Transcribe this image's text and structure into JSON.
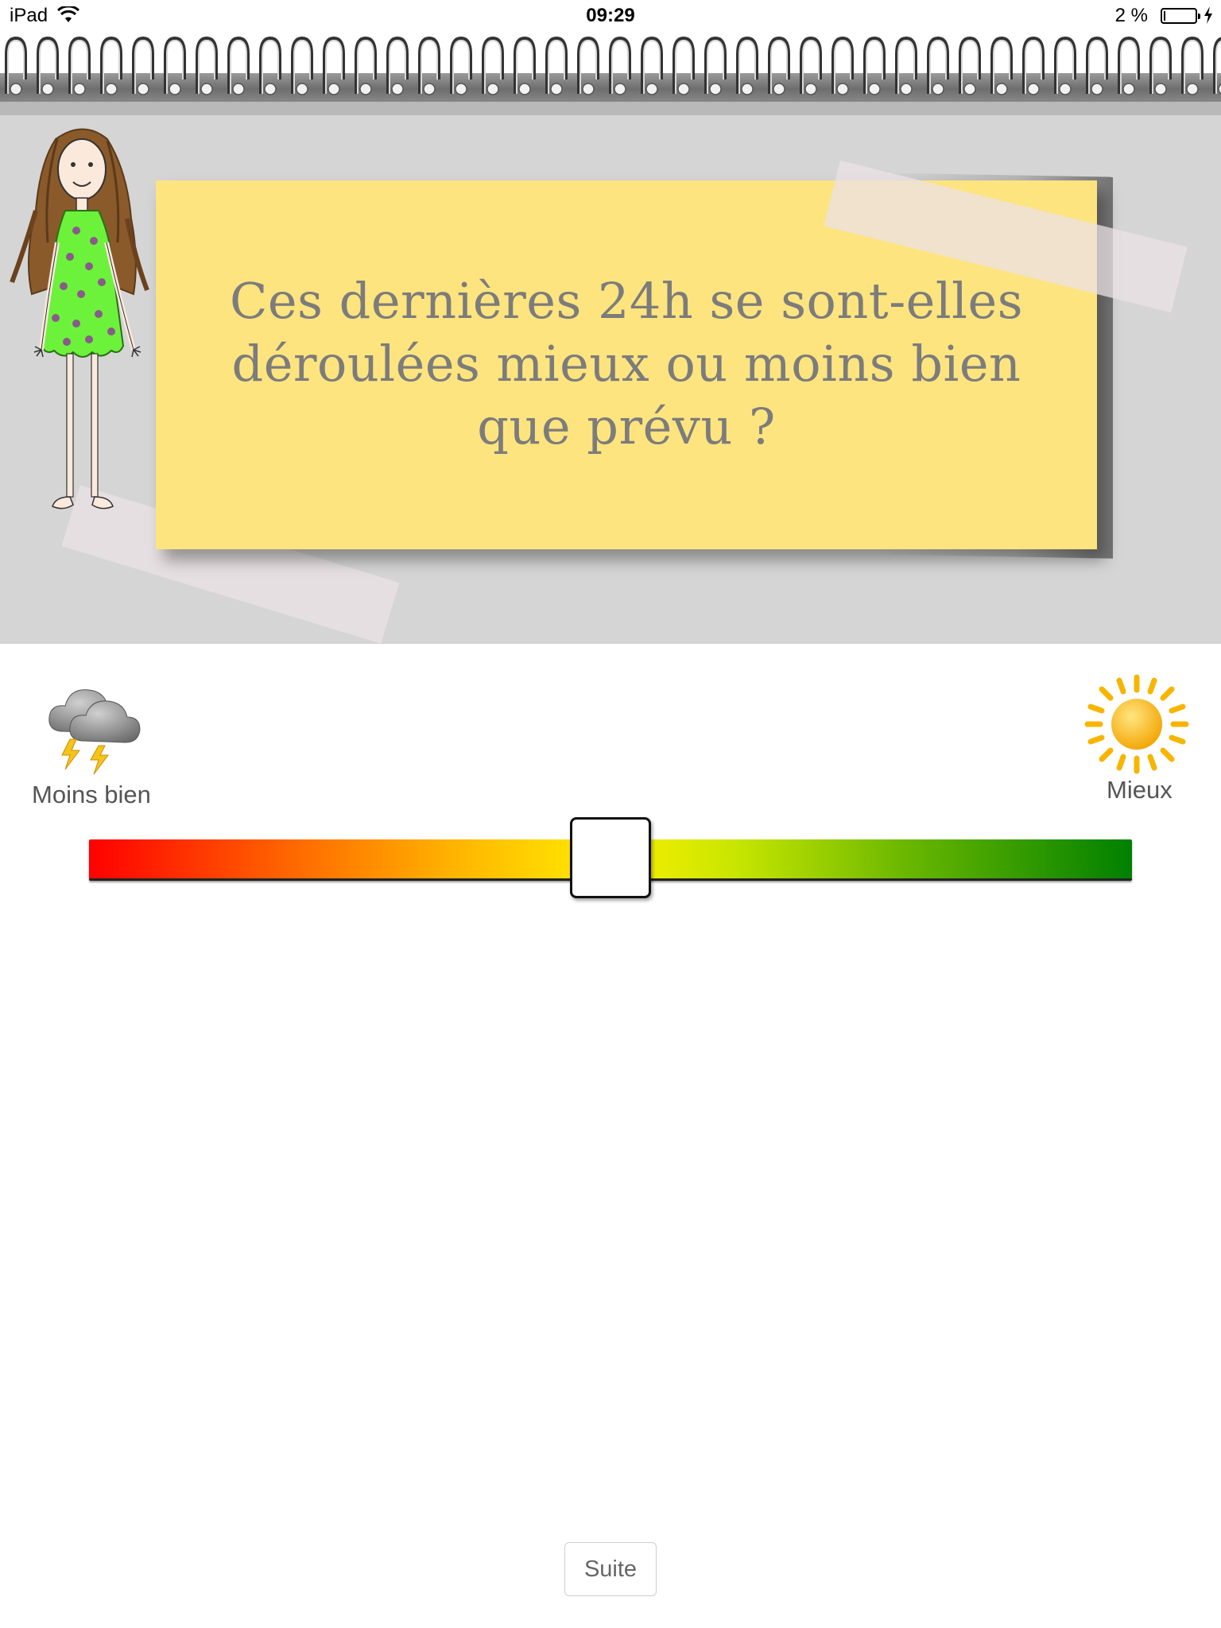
{
  "status_bar": {
    "device": "iPad",
    "time": "09:29",
    "battery": "2 %",
    "battery_level_percent": 2,
    "icons": [
      "wifi-icon",
      "battery-icon",
      "charging-icon"
    ]
  },
  "question": {
    "line1": "Ces dernières 24h se sont-elles",
    "line2": "déroulées mieux ou moins bien",
    "line3": "que prévu ?"
  },
  "scale": {
    "left_label": "Moins bien",
    "right_label": "Mieux",
    "left_icon": "storm-cloud-icon",
    "right_icon": "sun-icon",
    "slider_value_percent": 50,
    "gradient_colors": [
      "#ff0000",
      "#ffef00",
      "#008000"
    ]
  },
  "footer": {
    "next_button": "Suite"
  },
  "colors": {
    "note": "#fde47f",
    "header_bg": "#d5d5d5",
    "question_text": "#7c7c7c",
    "dress": "#6cf23a"
  }
}
